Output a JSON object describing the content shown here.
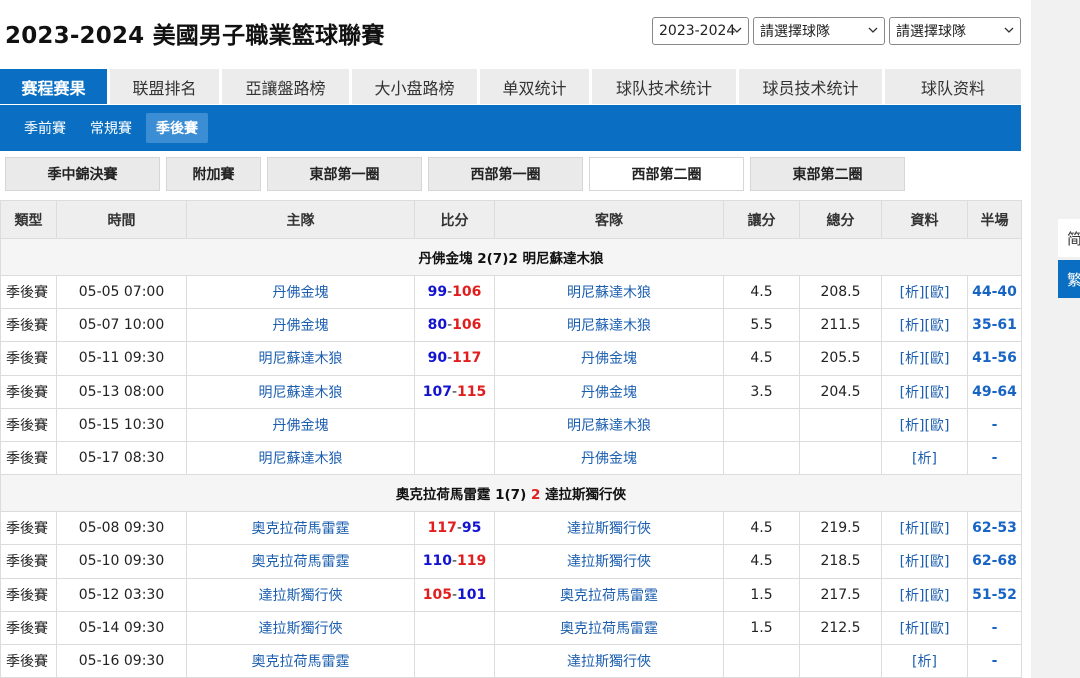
{
  "header": {
    "title": "2023-2024 美國男子職業籃球聯賽",
    "season_select": "2023-2024",
    "team_select_1": "請選擇球隊",
    "team_select_2": "請選擇球隊"
  },
  "tabs": [
    "赛程赛果",
    "联盟排名",
    "亞讓盤路榜",
    "大小盘路榜",
    "单双统计",
    "球队技术统计",
    "球员技术统计",
    "球队资料"
  ],
  "subtabs": [
    "季前賽",
    "常規賽",
    "季後賽"
  ],
  "rounds": [
    "季中錦決賽",
    "附加賽",
    "東部第一圈",
    "西部第一圈",
    "西部第二圈",
    "東部第二圈"
  ],
  "columns": [
    "類型",
    "時間",
    "主隊",
    "比分",
    "客隊",
    "讓分",
    "總分",
    "資料",
    "半場"
  ],
  "series": [
    {
      "summary_a": "丹佛金塊 2(7)2 明尼蘇達木狼",
      "summary_b": "",
      "summary_c": "",
      "games": [
        {
          "type": "季後賽",
          "time": "05-05 07:00",
          "home": "丹佛金塊",
          "score_home": "99",
          "dash": "-",
          "score_away": "106",
          "away": "明尼蘇達木狼",
          "handicap": "4.5",
          "total": "208.5",
          "info": "[析][歐]",
          "half": "44-40"
        },
        {
          "type": "季後賽",
          "time": "05-07 10:00",
          "home": "丹佛金塊",
          "score_home": "80",
          "dash": "-",
          "score_away": "106",
          "away": "明尼蘇達木狼",
          "handicap": "5.5",
          "total": "211.5",
          "info": "[析][歐]",
          "half": "35-61"
        },
        {
          "type": "季後賽",
          "time": "05-11 09:30",
          "home": "明尼蘇達木狼",
          "score_home": "90",
          "dash": "-",
          "score_away": "117",
          "away": "丹佛金塊",
          "handicap": "4.5",
          "total": "205.5",
          "info": "[析][歐]",
          "half": "41-56"
        },
        {
          "type": "季後賽",
          "time": "05-13 08:00",
          "home": "明尼蘇達木狼",
          "score_home": "107",
          "dash": "-",
          "score_away": "115",
          "away": "丹佛金塊",
          "handicap": "3.5",
          "total": "204.5",
          "info": "[析][歐]",
          "half": "49-64"
        },
        {
          "type": "季後賽",
          "time": "05-15 10:30",
          "home": "丹佛金塊",
          "score_home": "",
          "dash": "",
          "score_away": "",
          "away": "明尼蘇達木狼",
          "handicap": "",
          "total": "",
          "info": "[析][歐]",
          "half": "-"
        },
        {
          "type": "季後賽",
          "time": "05-17 08:30",
          "home": "明尼蘇達木狼",
          "score_home": "",
          "dash": "",
          "score_away": "",
          "away": "丹佛金塊",
          "handicap": "",
          "total": "",
          "info": "[析]",
          "half": "-"
        }
      ]
    },
    {
      "summary_a": "奧克拉荷馬雷霆 1(7)",
      "summary_b": "2",
      "summary_c": "達拉斯獨行俠",
      "games": [
        {
          "type": "季後賽",
          "time": "05-08 09:30",
          "home": "奧克拉荷馬雷霆",
          "score_home": "117",
          "dash": "-",
          "score_away": "95",
          "away": "達拉斯獨行俠",
          "handicap": "4.5",
          "total": "219.5",
          "info": "[析][歐]",
          "half": "62-53"
        },
        {
          "type": "季後賽",
          "time": "05-10 09:30",
          "home": "奧克拉荷馬雷霆",
          "score_home": "110",
          "dash": "-",
          "score_away": "119",
          "away": "達拉斯獨行俠",
          "handicap": "4.5",
          "total": "218.5",
          "info": "[析][歐]",
          "half": "62-68"
        },
        {
          "type": "季後賽",
          "time": "05-12 03:30",
          "home": "達拉斯獨行俠",
          "score_home": "105",
          "dash": "-",
          "score_away": "101",
          "away": "奧克拉荷馬雷霆",
          "handicap": "1.5",
          "total": "217.5",
          "info": "[析][歐]",
          "half": "51-52"
        },
        {
          "type": "季後賽",
          "time": "05-14 09:30",
          "home": "達拉斯獨行俠",
          "score_home": "",
          "dash": "",
          "score_away": "",
          "away": "奧克拉荷馬雷霆",
          "handicap": "1.5",
          "total": "212.5",
          "info": "[析][歐]",
          "half": "-"
        },
        {
          "type": "季後賽",
          "time": "05-16 09:30",
          "home": "奧克拉荷馬雷霆",
          "score_home": "",
          "dash": "",
          "score_away": "",
          "away": "達拉斯獨行俠",
          "handicap": "",
          "total": "",
          "info": "[析]",
          "half": "-"
        }
      ]
    }
  ],
  "side": {
    "simplified": "简",
    "traditional": "繁"
  },
  "colors": {
    "primary": "#0a6fc2",
    "home_win": "#e01e1e",
    "away_score": "#1414d0",
    "link": "#1c5fb0"
  }
}
